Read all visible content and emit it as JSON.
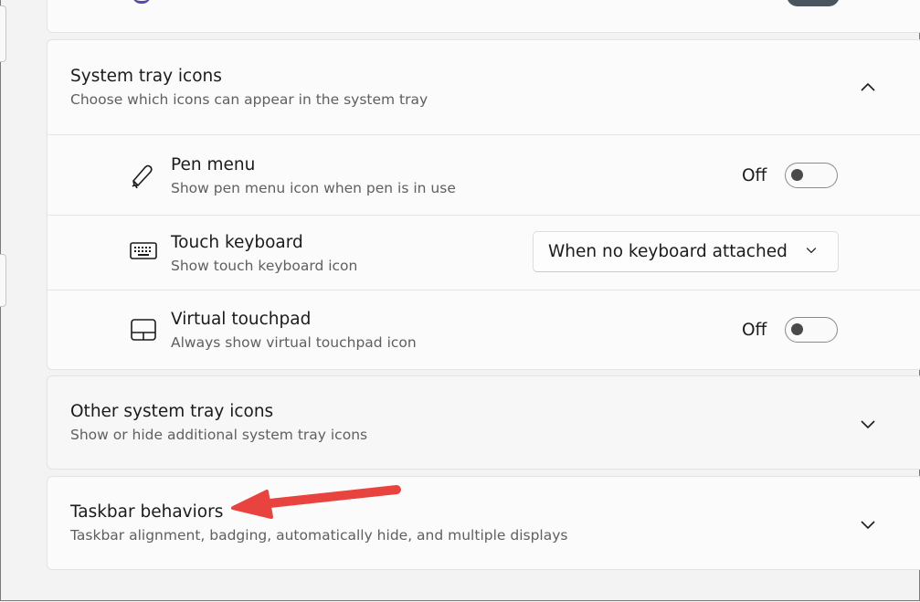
{
  "system_tray": {
    "title": "System tray icons",
    "subtitle": "Choose which icons can appear in the system tray",
    "items": [
      {
        "title": "Pen menu",
        "subtitle": "Show pen menu icon when pen is in use",
        "control": "toggle",
        "state_label": "Off",
        "icon": "pen-icon"
      },
      {
        "title": "Touch keyboard",
        "subtitle": "Show touch keyboard icon",
        "control": "dropdown",
        "value": "When no keyboard attached",
        "icon": "keyboard-icon"
      },
      {
        "title": "Virtual touchpad",
        "subtitle": "Always show virtual touchpad icon",
        "control": "toggle",
        "state_label": "Off",
        "icon": "touchpad-icon"
      }
    ]
  },
  "other_tray": {
    "title": "Other system tray icons",
    "subtitle": "Show or hide additional system tray icons"
  },
  "taskbar_behaviors": {
    "title": "Taskbar behaviors",
    "subtitle": "Taskbar alignment, badging, automatically hide, and multiple displays"
  },
  "colors": {
    "annotation_arrow": "#e8433f",
    "toggle_knob": "#4a4a4a"
  }
}
